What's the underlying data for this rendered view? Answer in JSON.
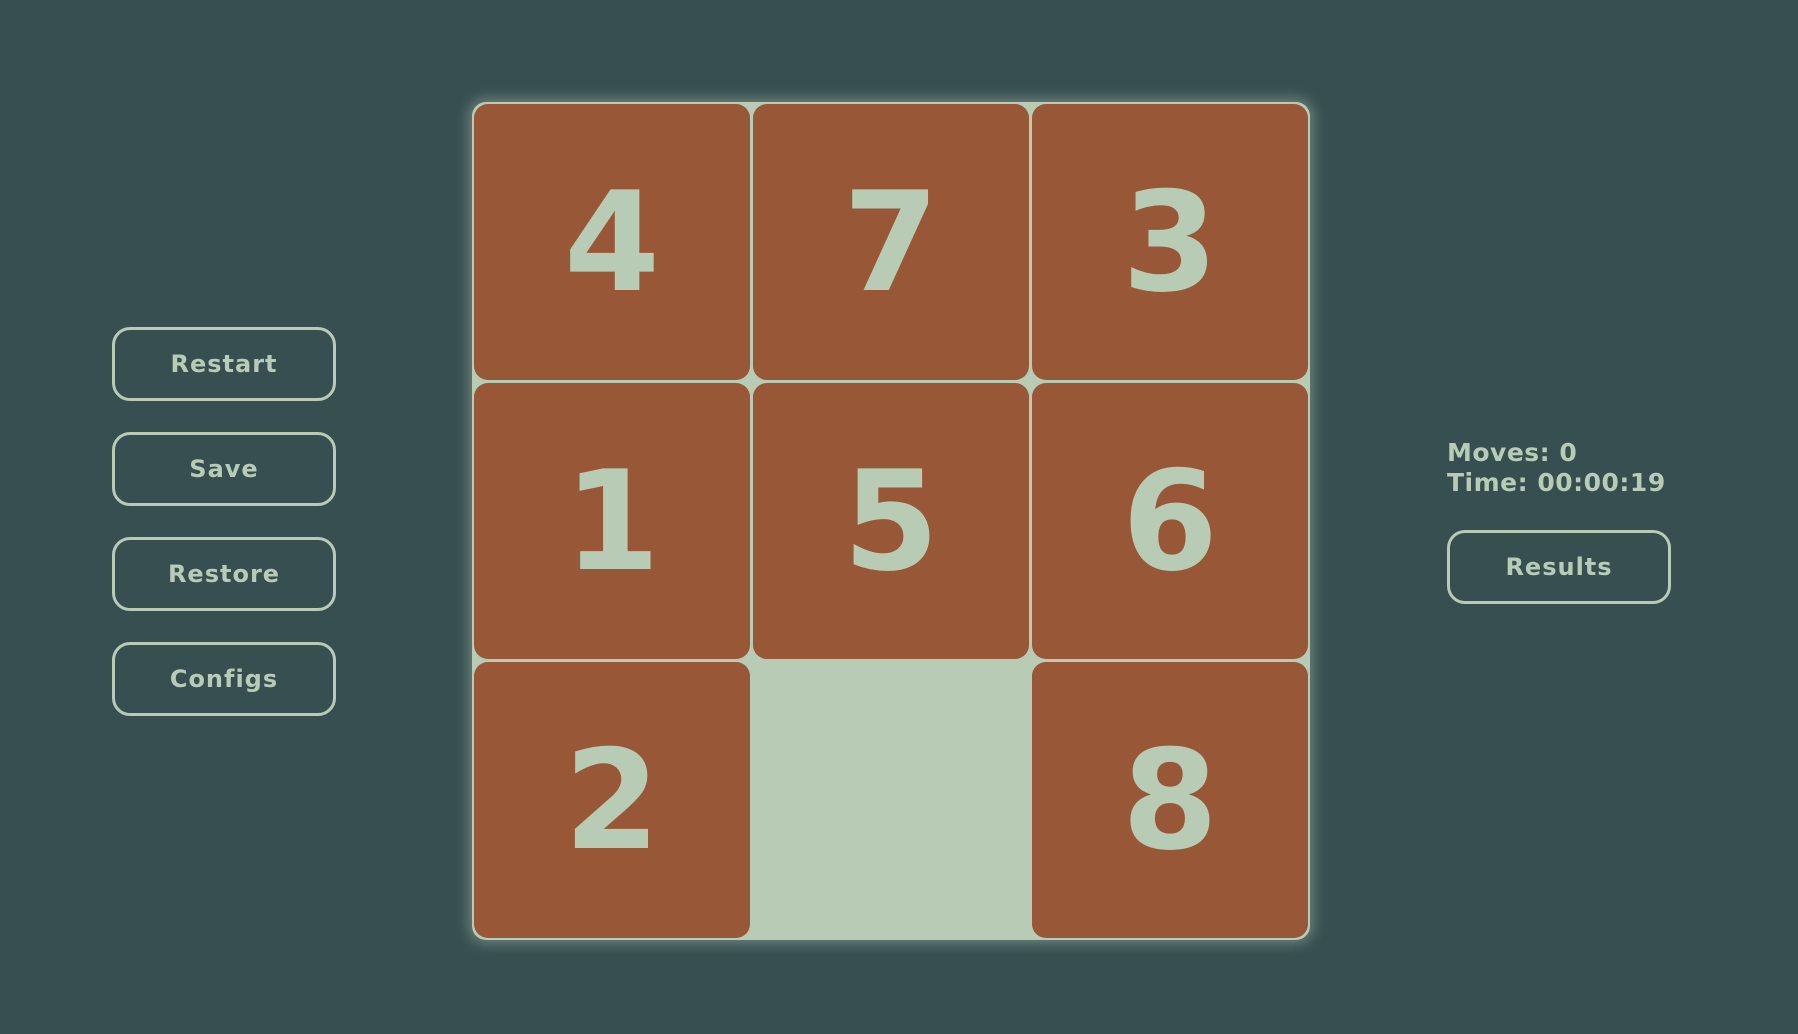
{
  "controls": {
    "restart_label": "Restart",
    "save_label": "Save",
    "restore_label": "Restore",
    "configs_label": "Configs",
    "results_label": "Results"
  },
  "stats": {
    "moves_label": "Moves:",
    "moves_value": "0",
    "time_label": "Time:",
    "time_value": "00:00:19"
  },
  "puzzle": {
    "size": "3x3",
    "rows": [
      [
        "4",
        "7",
        "3"
      ],
      [
        "1",
        "5",
        "6"
      ],
      [
        "2",
        "",
        "8"
      ]
    ]
  },
  "colors": {
    "background": "#374f51",
    "tile": "#985737",
    "board_and_text": "#b7cbb5"
  }
}
